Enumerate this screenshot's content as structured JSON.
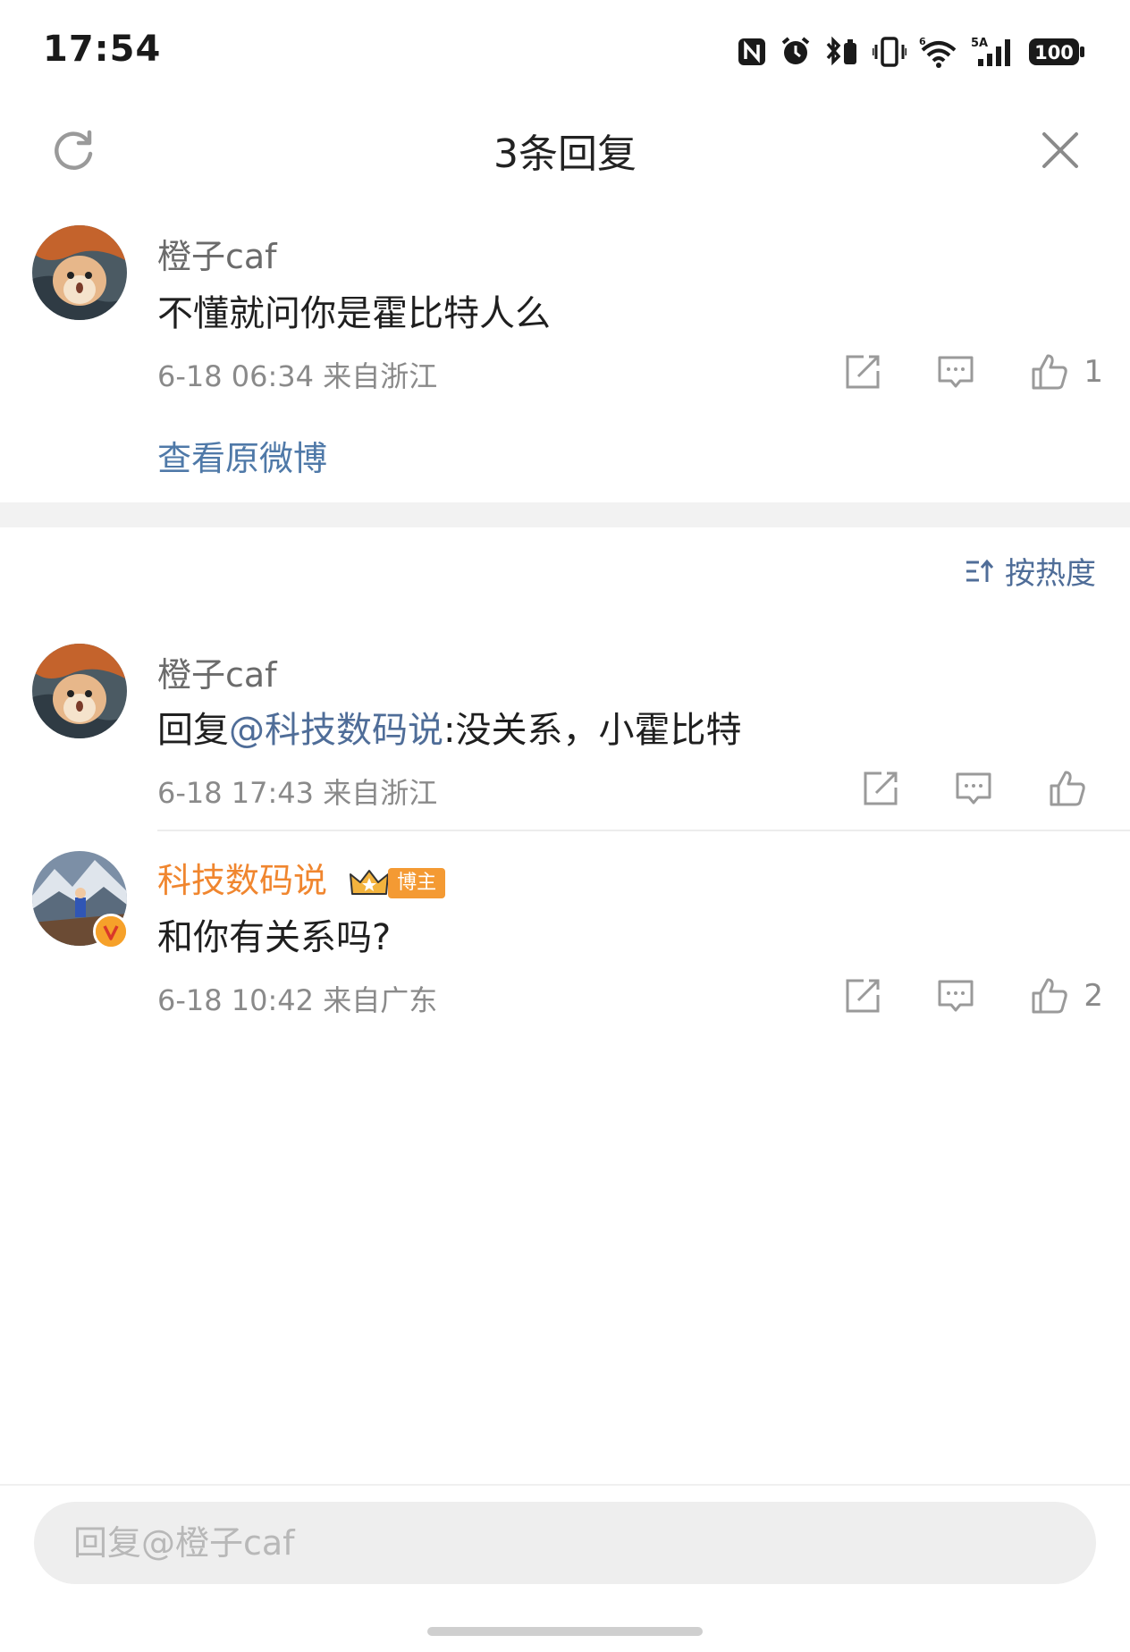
{
  "status_bar": {
    "time": "17:54",
    "network_label": "5A",
    "wifi_label": "6",
    "battery": "100"
  },
  "header": {
    "title": "3条回复"
  },
  "root_comment": {
    "username": "橙子caf",
    "text": "不懂就问你是霍比特人么",
    "meta": "6-18 06:34 来自浙江",
    "like_count": "1",
    "view_original_label": "查看原微博"
  },
  "sort": {
    "label": "按热度"
  },
  "replies": [
    {
      "username": "橙子caf",
      "text_prefix": "回复",
      "mention": "@科技数码说",
      "text_suffix": ":没关系，小霍比特",
      "meta": "6-18 17:43 来自浙江",
      "like_count": ""
    },
    {
      "username": "科技数码说",
      "badge_label": "博主",
      "text": "和你有关系吗?",
      "meta": "6-18 10:42 来自广东",
      "like_count": "2"
    }
  ],
  "reply_bar": {
    "placeholder": "回复@橙子caf"
  },
  "colors": {
    "mention": "#4f6d98",
    "author_name": "#f0862f",
    "link": "#4f79a8",
    "meta": "#8a8a8a"
  }
}
